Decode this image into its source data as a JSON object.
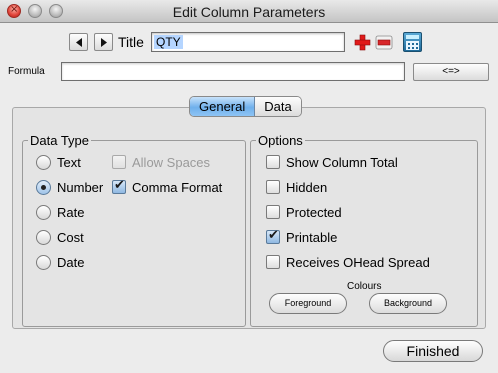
{
  "window": {
    "title": "Edit Column Parameters"
  },
  "toolbar": {
    "title_label": "Title",
    "title_value": "QTY",
    "icons": [
      "prev-arrow-icon",
      "next-arrow-icon",
      "add-plus-icon",
      "remove-minus-icon",
      "calculator-icon"
    ]
  },
  "formula": {
    "label": "Formula",
    "value": "",
    "button_label": "<=>"
  },
  "tabs": [
    {
      "label": "General",
      "active": true
    },
    {
      "label": "Data",
      "active": false
    }
  ],
  "data_type": {
    "title": "Data Type",
    "options": [
      {
        "label": "Text",
        "selected": false
      },
      {
        "label": "Number",
        "selected": true
      },
      {
        "label": "Rate",
        "selected": false
      },
      {
        "label": "Cost",
        "selected": false
      },
      {
        "label": "Date",
        "selected": false
      }
    ],
    "allow_spaces": {
      "label": "Allow Spaces",
      "checked": false,
      "enabled": false
    },
    "comma_format": {
      "label": "Comma Format",
      "checked": true,
      "enabled": true
    }
  },
  "options": {
    "title": "Options",
    "items": [
      {
        "label": "Show Column Total",
        "checked": false
      },
      {
        "label": "Hidden",
        "checked": false
      },
      {
        "label": "Protected",
        "checked": false
      },
      {
        "label": "Printable",
        "checked": true
      },
      {
        "label": "Receives OHead Spread",
        "checked": false
      }
    ],
    "colours_label": "Colours",
    "foreground_label": "Foreground",
    "background_label": "Background"
  },
  "footer": {
    "finished_label": "Finished"
  },
  "colors": {
    "accent_tab": "#6fb0ec",
    "selection": "#b5d5ff",
    "remove_red": "#d8262a",
    "add_red": "#e11a1a"
  }
}
